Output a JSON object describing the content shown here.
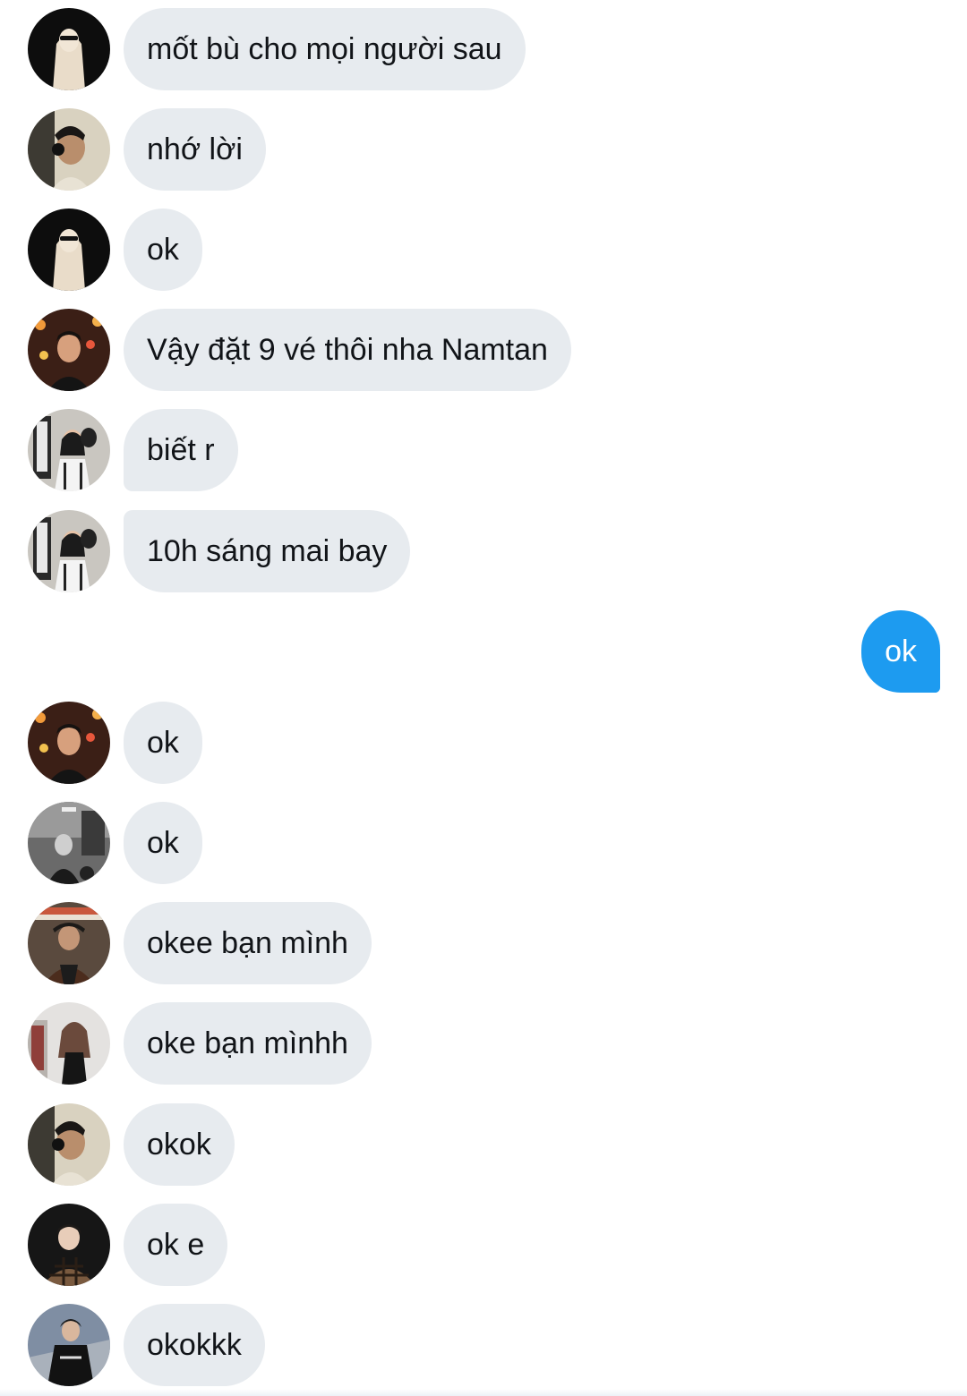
{
  "messages": [
    {
      "text": "mốt bù cho mọi người sau",
      "avatar": "avatar-long-hair-sunglasses"
    },
    {
      "text": "nhớ lời",
      "avatar": "avatar-headphones-profile"
    },
    {
      "text": "ok",
      "avatar": "avatar-long-hair-sunglasses"
    },
    {
      "text": "Vậy đặt 9 vé thôi nha Namtan",
      "avatar": "avatar-night-lights"
    },
    {
      "text": "biết r",
      "avatar": "avatar-mirror-couple"
    },
    {
      "text": "10h sáng mai bay",
      "avatar": "avatar-mirror-couple"
    },
    {
      "text": "ok",
      "avatar": "avatar-night-lights"
    },
    {
      "text": "ok",
      "avatar": "avatar-monochrome-street"
    },
    {
      "text": "okee bạn mình",
      "avatar": "avatar-cap-brown-jacket"
    },
    {
      "text": "oke bạn mìnhh",
      "avatar": "avatar-woman-black-dress"
    },
    {
      "text": "okok",
      "avatar": "avatar-headphones-profile"
    },
    {
      "text": "ok e",
      "avatar": "avatar-plaid-jacket"
    },
    {
      "text": "okokkk",
      "avatar": "avatar-stairs-black-shirt"
    }
  ],
  "outgoing": {
    "text": "ok"
  },
  "colors": {
    "incoming_bubble": "#e7ebef",
    "outgoing_bubble": "#1d9bf0",
    "text": "#111418"
  }
}
